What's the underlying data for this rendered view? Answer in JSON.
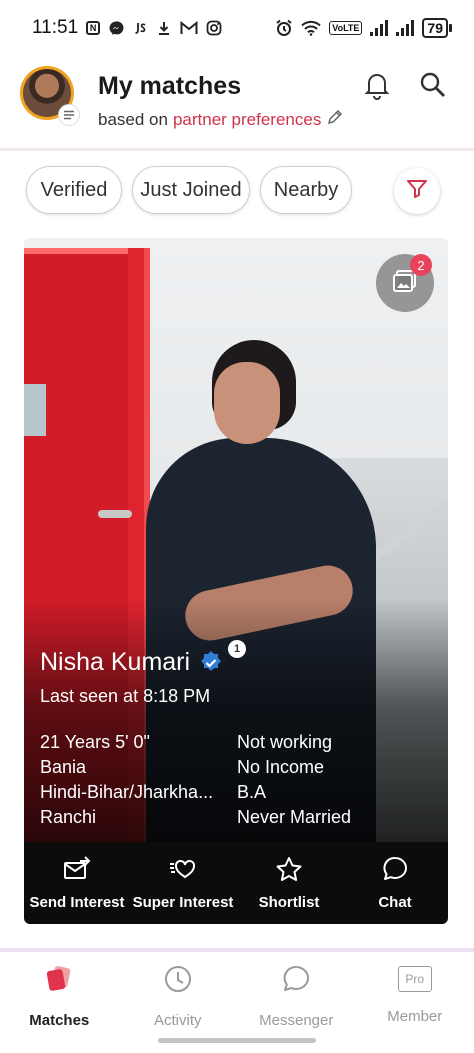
{
  "status_bar": {
    "time": "11:51",
    "left_icons": [
      "nfc-icon",
      "messenger-icon",
      "js-icon",
      "download-icon",
      "gmail-icon",
      "instagram-icon"
    ],
    "right_icons": [
      "alarm-icon",
      "wifi-icon",
      "volte-icon",
      "signal-icon",
      "signal-icon"
    ],
    "volte": "VoLTE",
    "battery": "79"
  },
  "header": {
    "title": "My matches",
    "subtitle_prefix": "based on",
    "subtitle_link": "partner preferences",
    "icons": [
      "bell-icon",
      "search-icon",
      "pencil-icon",
      "menu-icon"
    ]
  },
  "filters": {
    "chips": [
      "Verified",
      "Just Joined",
      "Nearby"
    ],
    "filter_icon": "funnel-icon"
  },
  "profile": {
    "gallery_count": "2",
    "name": "Nisha Kumari",
    "verified_count": "1",
    "last_seen": "Last seen at 8:18 PM",
    "details_left": [
      "21 Years 5' 0\"",
      "Bania",
      "Hindi-Bihar/Jharkha...",
      "Ranchi"
    ],
    "details_right": [
      "Not working",
      "No Income",
      "B.A",
      "Never Married"
    ]
  },
  "actions": [
    {
      "label": "Send Interest",
      "icon": "send-interest-icon"
    },
    {
      "label": "Super Interest",
      "icon": "super-interest-icon"
    },
    {
      "label": "Shortlist",
      "icon": "star-icon"
    },
    {
      "label": "Chat",
      "icon": "chat-bubble-icon"
    }
  ],
  "bottom_nav": {
    "items": [
      "Matches",
      "Activity",
      "Messenger",
      "Member"
    ],
    "pro_label": "Pro",
    "active": "Matches"
  },
  "colors": {
    "accent": "#d0344c",
    "avatar_ring": "#f2a321",
    "action_bar": "#0c0c0c",
    "badge": "#e8435a",
    "verified": "#2f7fd8"
  }
}
